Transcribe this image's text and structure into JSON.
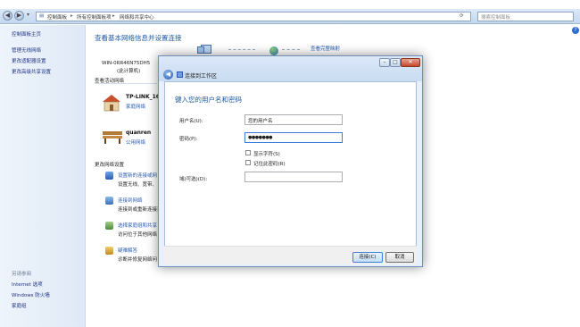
{
  "address_bar": {
    "crumbs": [
      "控制面板",
      "所有控制面板项",
      "网络和共享中心"
    ],
    "search_placeholder": "搜索控制面板"
  },
  "sidebar": {
    "items": [
      "控制面板主页",
      "管理无线网络",
      "更改适配器设置",
      "更改高级共享设置"
    ],
    "see_also_header": "另请参阅",
    "see_also": [
      "Internet 选项",
      "Windows 防火墙",
      "家庭组"
    ]
  },
  "main": {
    "heading": "查看基本网络信息并设置连接",
    "full_map_link": "查看完整映射",
    "computer_name": "WIN-0RR46N75DH5",
    "computer_sub": "(此计算机)",
    "active_networks_heading": "查看活动网络",
    "net1_name": "TP-LINK_16",
    "net1_type": "家庭网络",
    "net2_name": "quanren",
    "net2_type": "公用网络",
    "change_settings_heading": "更改网络设置",
    "tasks": [
      {
        "title": "设置新的连接或网",
        "desc": "设置无线、宽带、"
      },
      {
        "title": "连接到网络",
        "desc": "连接到或重新连接到"
      },
      {
        "title": "选择家庭组和共享",
        "desc": "访问位于其他网络"
      },
      {
        "title": "疑难解答",
        "desc": "诊断并修复网络问"
      }
    ]
  },
  "dialog": {
    "title": "连接到工作区",
    "heading": "键入您的用户名和密码",
    "username_label": "用户名(U):",
    "username_value": "您的用户名",
    "password_label": "密码(P):",
    "password_value": "●●●●●●●",
    "show_chars_label": "显示字符(S)",
    "remember_label": "记住此密码(R)",
    "domain_label": "域(可选)(D):",
    "domain_value": "",
    "connect_button": "连接(C)",
    "cancel_button": "取消"
  },
  "colors": {
    "accent": "#2a5bb0",
    "heading": "#1e5aa8"
  }
}
